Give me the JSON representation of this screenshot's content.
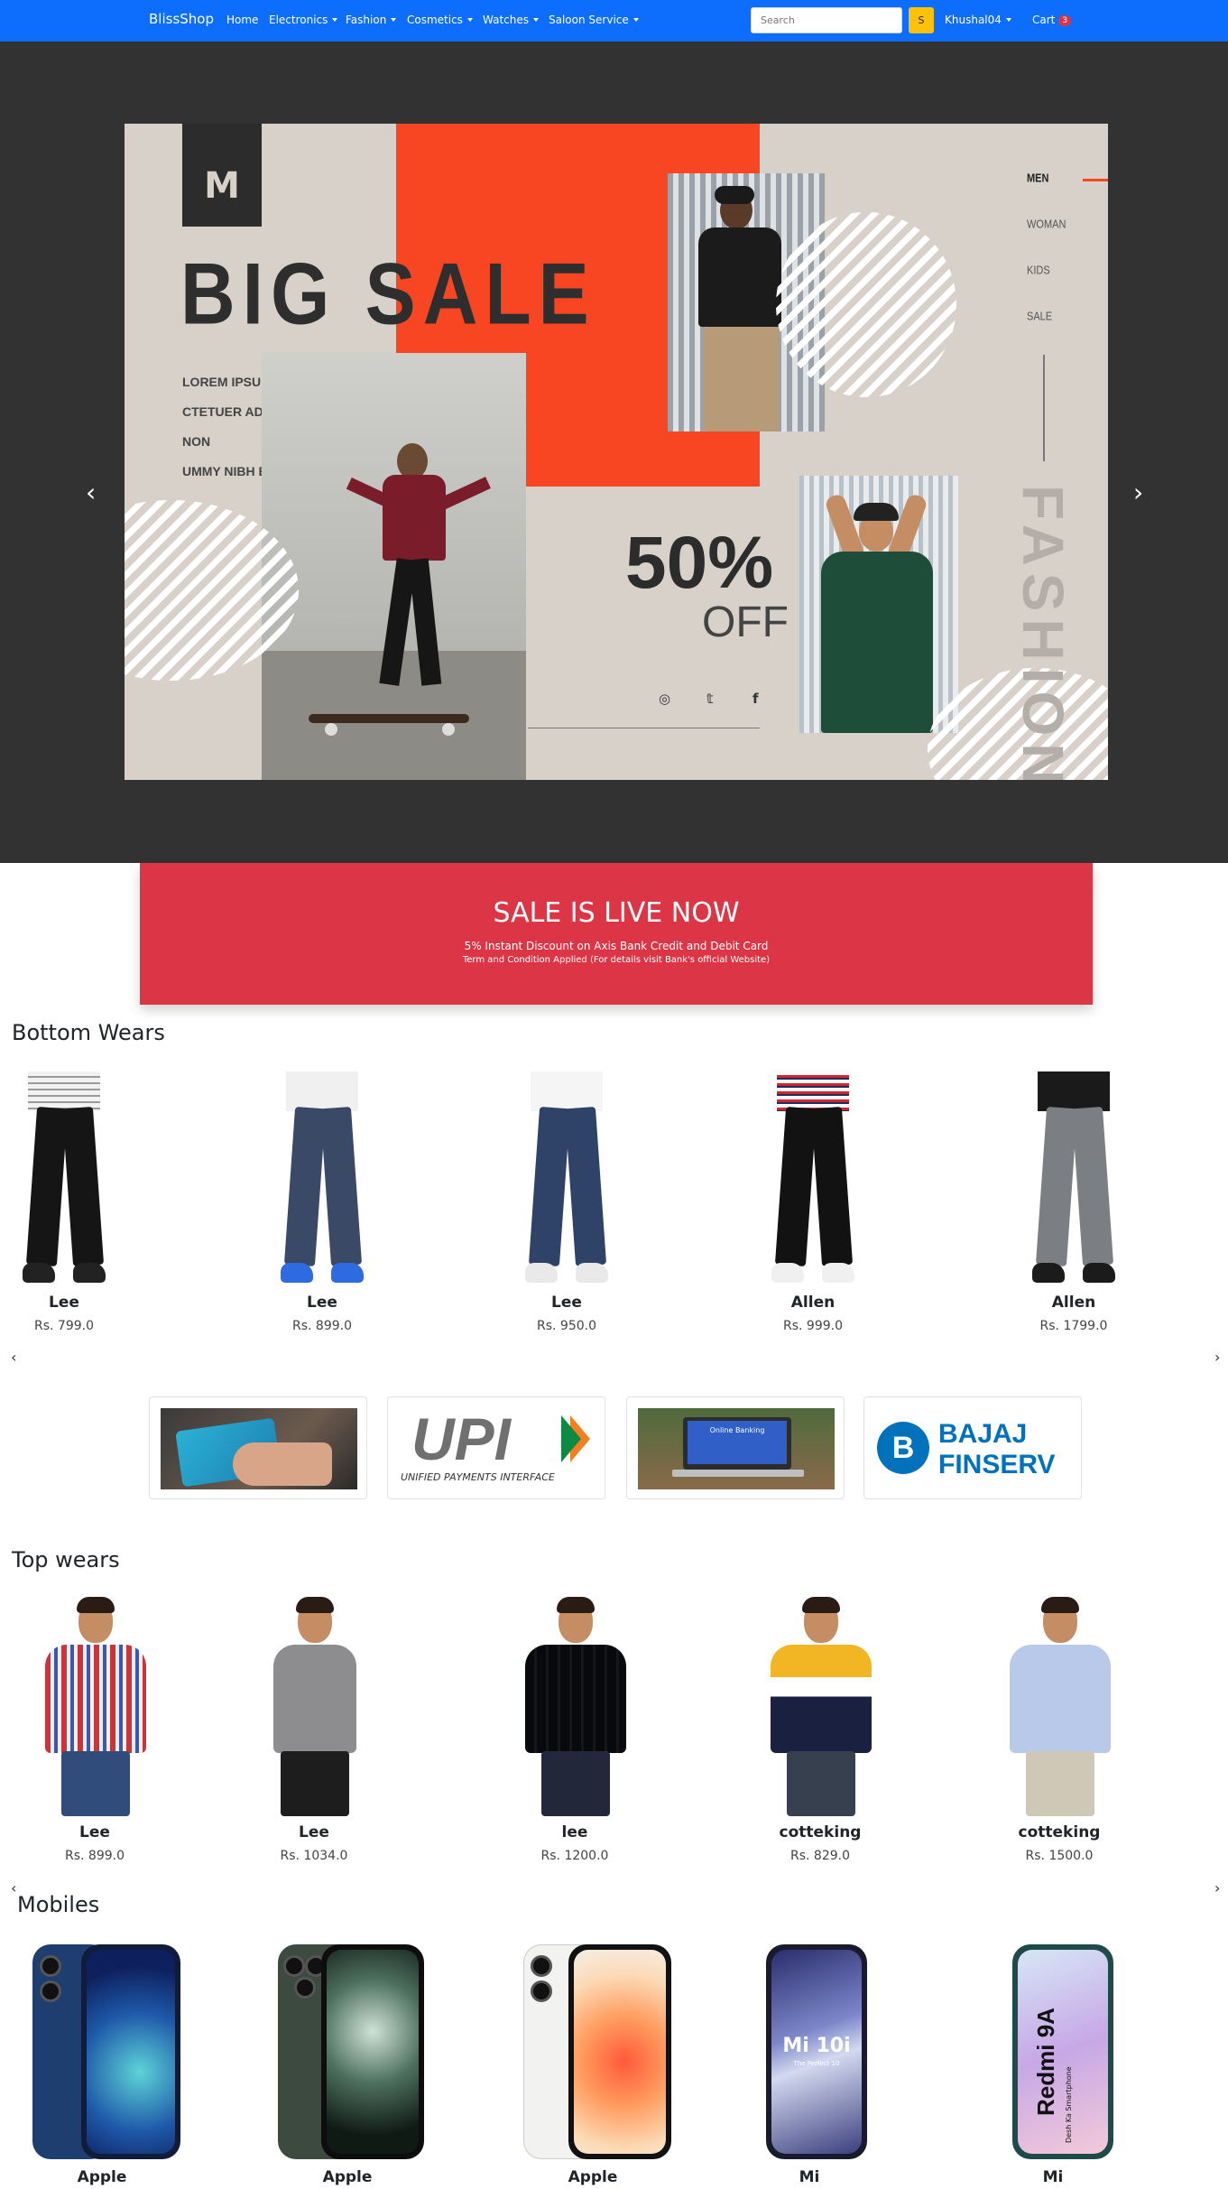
{
  "navbar": {
    "brand": "BlissShop",
    "links": [
      {
        "label": "Home"
      },
      {
        "label": "Electronics"
      },
      {
        "label": "Fashion"
      },
      {
        "label": "Cosmetics"
      },
      {
        "label": "Watches"
      },
      {
        "label": "Saloon Service"
      }
    ],
    "search_placeholder": "Search",
    "search_button": "S",
    "user": "Khushal04",
    "cart_label": "Cart",
    "cart_count": "3"
  },
  "hero": {
    "letter": "M",
    "headline": "BIG SALE",
    "body_lines": [
      "LOREM IPSUM DOLOR SIT AMET, CONSE",
      "CTETUER ADIPIS CING ELIT, SED DIAM NON",
      "UMMY NIBH EUIS."
    ],
    "discount": "50%",
    "off": "OFF",
    "menu": [
      "MEN",
      "WOMAN",
      "KIDS",
      "SALE"
    ],
    "vertical_word": "FASHION",
    "social": [
      "instagram-icon",
      "twitter-icon",
      "facebook-icon"
    ],
    "prev_arrow": "‹",
    "next_arrow": "›"
  },
  "sale_banner": {
    "title": "SALE IS LIVE NOW",
    "subtitle": "5% Instant Discount on Axis Bank Credit and Debit Card",
    "note": "Term and Condition Applied (For details visit Bank's official Website)",
    "color": "#dc3545"
  },
  "bottom_wears": {
    "title": "Bottom Wears",
    "items": [
      {
        "brand": "Lee",
        "price": "Rs. 799.0"
      },
      {
        "brand": "Lee",
        "price": "Rs. 899.0"
      },
      {
        "brand": "Lee",
        "price": "Rs. 950.0"
      },
      {
        "brand": "Allen",
        "price": "Rs. 999.0"
      },
      {
        "brand": "Allen",
        "price": "Rs. 1799.0"
      }
    ]
  },
  "payments": {
    "upi_big": "UPI",
    "upi_caption": "UNIFIED PAYMENTS INTERFACE",
    "laptop_text": "Online Banking",
    "bajaj_line1": "BAJAJ",
    "bajaj_line2": "FINSERV"
  },
  "top_wears": {
    "title": "Top wears",
    "items": [
      {
        "brand": "Lee",
        "price": "Rs. 899.0"
      },
      {
        "brand": "Lee",
        "price": "Rs. 1034.0"
      },
      {
        "brand": "lee",
        "price": "Rs. 1200.0"
      },
      {
        "brand": "cotteking",
        "price": "Rs. 829.0"
      },
      {
        "brand": "cotteking",
        "price": "Rs. 1500.0"
      }
    ]
  },
  "mobiles": {
    "title": "Mobiles",
    "items": [
      {
        "brand": "Apple"
      },
      {
        "brand": "Apple"
      },
      {
        "brand": "Apple"
      },
      {
        "brand": "Mi",
        "screen_text": "Mi 10i",
        "screen_sub": "The Perfect 10"
      },
      {
        "brand": "Mi",
        "screen_text": "Redmi 9A",
        "screen_sub": "Desh Ka Smartphone"
      }
    ]
  },
  "carousel_arrows": {
    "left": "‹",
    "right": "›"
  }
}
